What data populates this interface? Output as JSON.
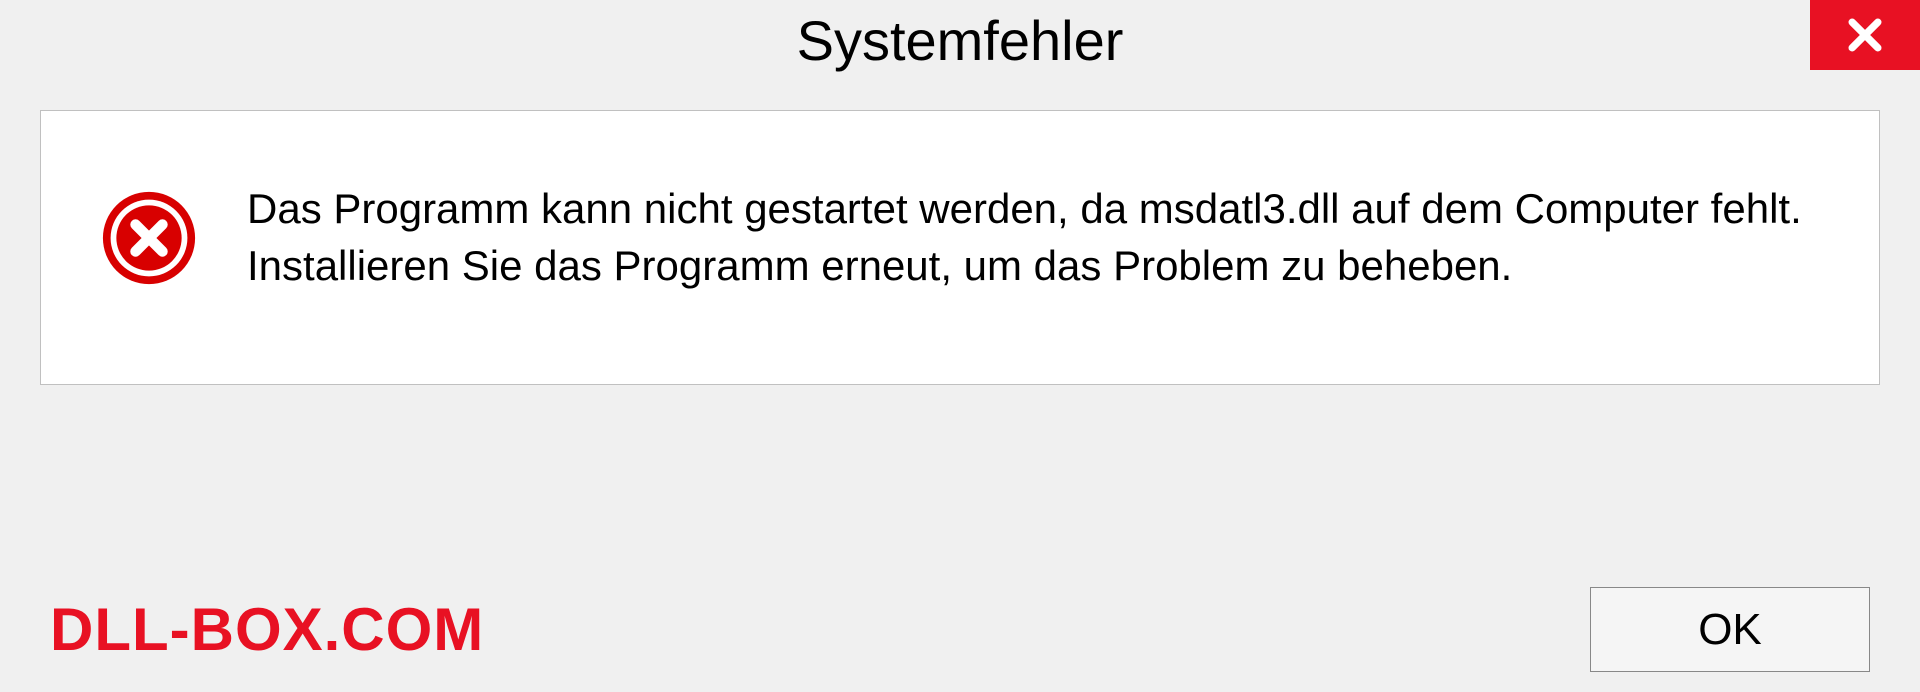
{
  "dialog": {
    "title": "Systemfehler",
    "message": "Das Programm kann nicht gestartet werden, da msdatl3.dll auf dem Computer fehlt. Installieren Sie das Programm erneut, um das Problem zu beheben.",
    "ok_label": "OK"
  },
  "watermark": "DLL-BOX.COM"
}
